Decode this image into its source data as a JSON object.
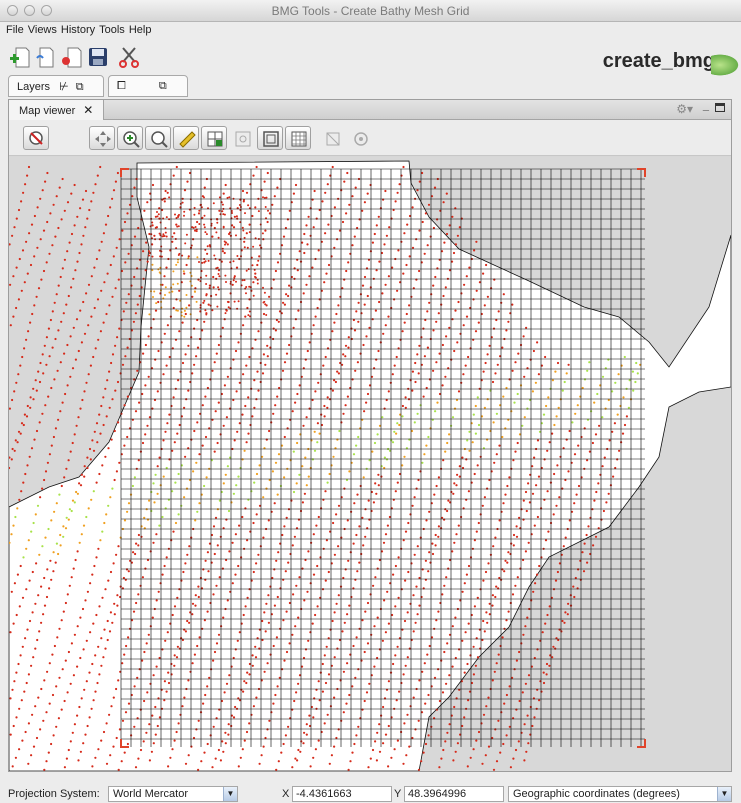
{
  "window": {
    "title": "BMG Tools - Create Bathy Mesh Grid"
  },
  "menu": [
    "File",
    "Views",
    "History",
    "Tools",
    "Help"
  ],
  "toolbar": {
    "brand": "create_bmg",
    "buttons": [
      "add-document",
      "open-document",
      "remove-document",
      "save",
      "cut"
    ]
  },
  "panels": {
    "layers_tab": "Layers"
  },
  "map_viewer": {
    "tab_label": "Map viewer",
    "close": "✕"
  },
  "status": {
    "projection_label": "Projection System:",
    "projection_value": "World Mercator",
    "x_label": "X",
    "x_value": "-4.4361663",
    "y_label": "Y",
    "y_value": "48.3964996",
    "coord_mode": "Geographic coordinates (degrees)"
  },
  "colors": {
    "sounding_deep": "#d62a1a",
    "sounding_mid": "#f0a020",
    "sounding_shallow": "#a8e24a",
    "grid": "#000000",
    "land": "#ffffff",
    "corner_marker": "#e0442a"
  }
}
